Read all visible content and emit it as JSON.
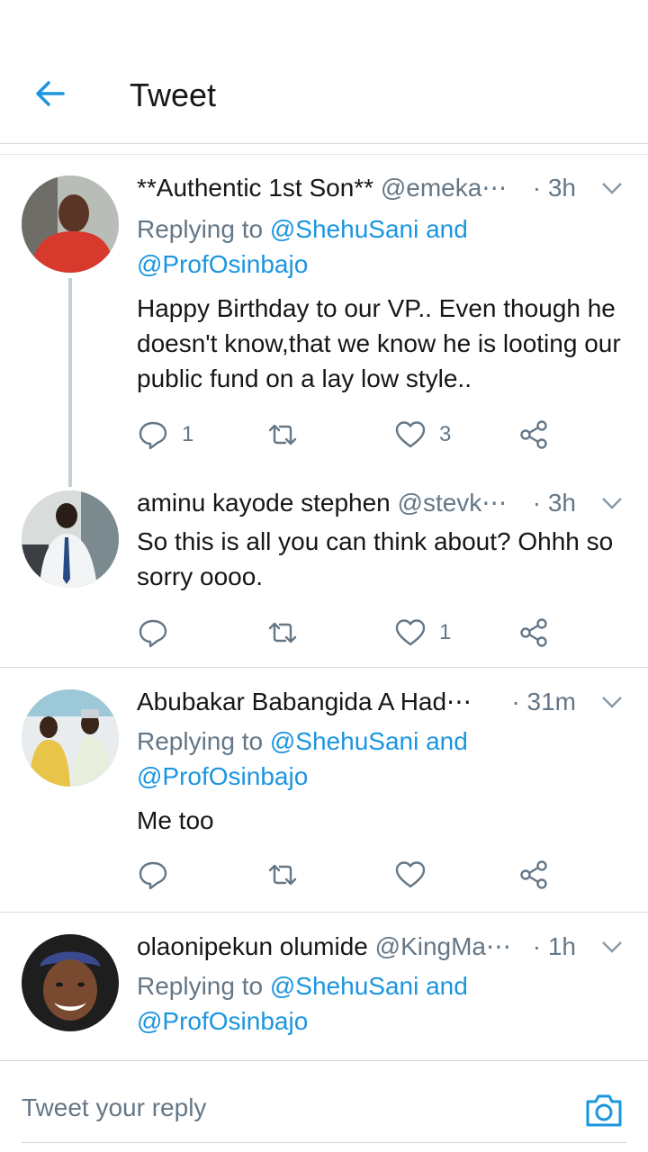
{
  "header": {
    "title": "Tweet"
  },
  "tweets": [
    {
      "name": "**Authentic 1st Son**",
      "handle": "@emeka⋯",
      "time": "· 3h",
      "replying_prefix": "Replying to",
      "replying_to_1": "@ShehuSani and",
      "replying_to_2": "@ProfOsinbajo",
      "text": "Happy Birthday to our VP.. Even though he doesn't know,that we know he is looting our public fund on a lay low style..",
      "reply_count": "1",
      "retweet_count": "",
      "like_count": "3"
    },
    {
      "name": "aminu kayode stephen",
      "handle": "@stevk⋯",
      "time": "· 3h",
      "text": "So this is all you can think about? Ohhh so sorry oooo.",
      "reply_count": "",
      "retweet_count": "",
      "like_count": "1"
    },
    {
      "name": "Abubakar Babangida A Had⋯",
      "handle": "",
      "time": "· 31m",
      "replying_prefix": "Replying to",
      "replying_to_1": "@ShehuSani and",
      "replying_to_2": "@ProfOsinbajo",
      "text": "Me too",
      "reply_count": "",
      "retweet_count": "",
      "like_count": ""
    },
    {
      "name": "olaonipekun olumide",
      "handle": "@KingMa⋯",
      "time": "· 1h",
      "replying_prefix": "Replying to",
      "replying_to_1": "@ShehuSani and",
      "replying_to_2": "@ProfOsinbajo"
    }
  ],
  "composer": {
    "placeholder": "Tweet your reply"
  },
  "colors": {
    "accent": "#1b95e0",
    "secondary_text": "#657786",
    "divider": "#d6dbe0"
  },
  "icons": [
    "back-arrow-icon",
    "reply-icon",
    "retweet-icon",
    "like-icon",
    "share-icon",
    "chevron-down-icon",
    "camera-icon"
  ]
}
